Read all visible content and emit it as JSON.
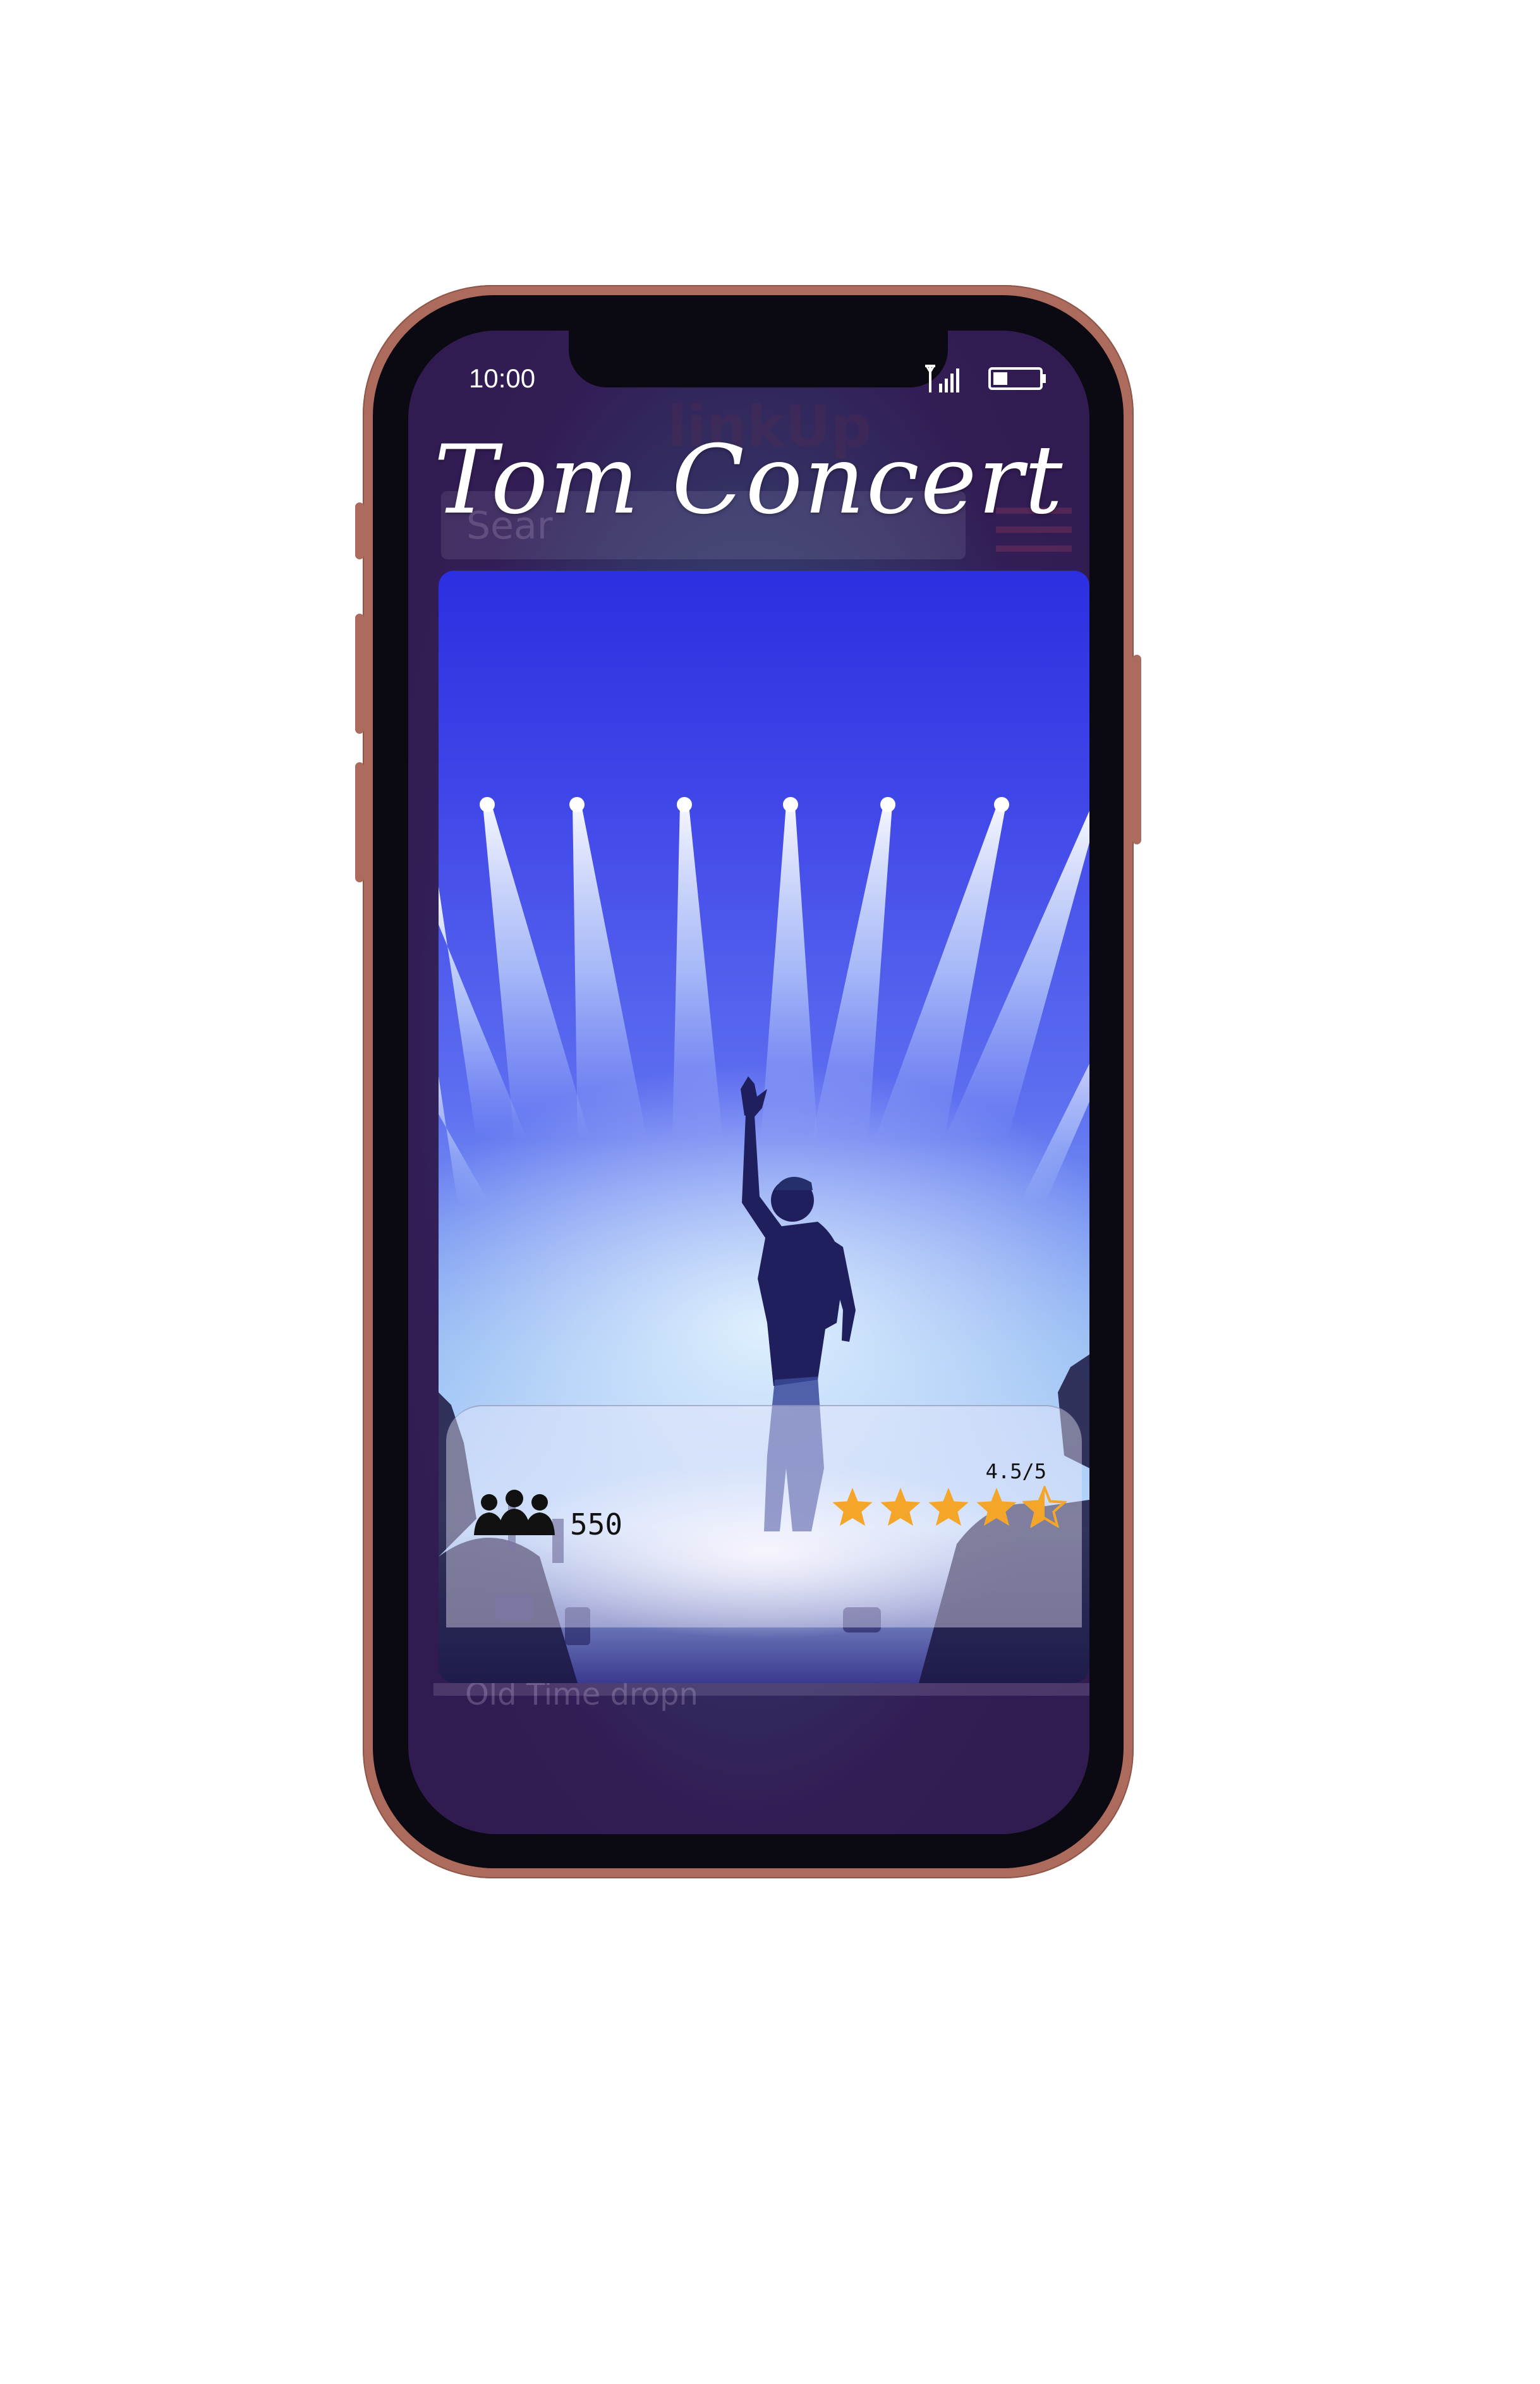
{
  "status_bar": {
    "time": "10:00",
    "icons": [
      "signal-icon",
      "battery-icon"
    ]
  },
  "background_app": {
    "logo_text": "linkUp",
    "search_placeholder": "Sear",
    "footer_text": "Old Time dropn"
  },
  "event": {
    "title": "Tom Concert",
    "attendee_icon": "people-group-icon",
    "attendee_count": "550",
    "rating_text": "4.5/5",
    "rating_value": 4.5,
    "rating_max": 5
  },
  "colors": {
    "phone_frame": "#ad6b5d",
    "star": "#f4a62a",
    "screen_bg": "#321d55"
  }
}
